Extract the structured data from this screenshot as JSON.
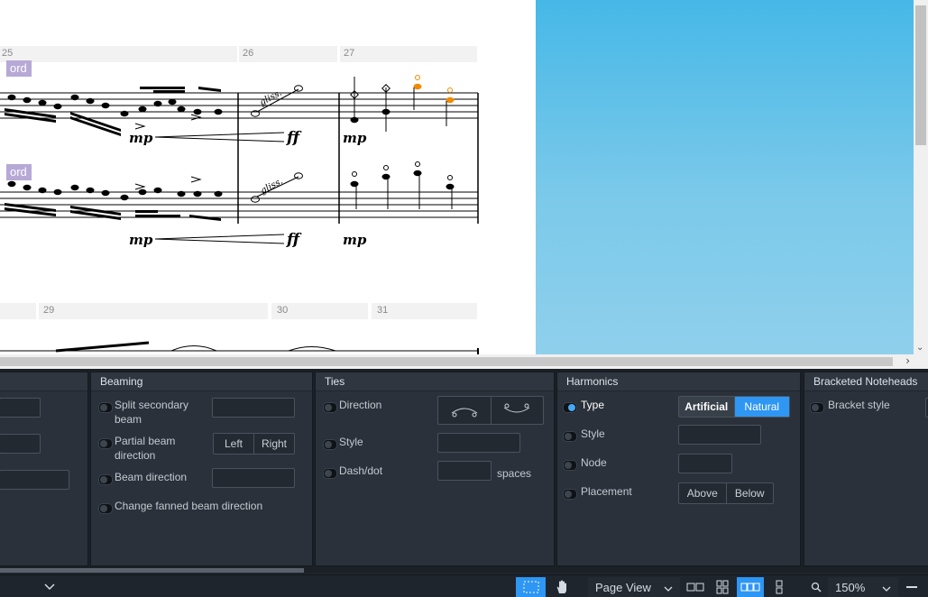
{
  "score": {
    "bar_numbers_top": [
      "25",
      "26",
      "27"
    ],
    "bar_numbers_bottom": [
      "29",
      "30",
      "31"
    ],
    "technique_top": "ord",
    "technique_bottom": "ord",
    "gliss_top": "gliss.",
    "gliss_bottom": "gliss.",
    "dyn_mp": "mp",
    "dyn_ff": "ff",
    "accent_color": "#f08a00",
    "highlight_color": "#b7a9d6"
  },
  "panels": {
    "beaming": {
      "title": "Beaming",
      "split_secondary": "Split secondary beam",
      "partial_direction": "Partial beam direction",
      "left": "Left",
      "right": "Right",
      "beam_direction": "Beam direction",
      "change_fanned": "Change fanned beam direction"
    },
    "ties": {
      "title": "Ties",
      "direction": "Direction",
      "style": "Style",
      "dash_dot": "Dash/dot",
      "spaces": "spaces"
    },
    "harmonics": {
      "title": "Harmonics",
      "type": "Type",
      "artificial": "Artificial",
      "natural": "Natural",
      "style": "Style",
      "node": "Node",
      "placement": "Placement",
      "above": "Above",
      "below": "Below"
    },
    "bracketed": {
      "title": "Bracketed Noteheads",
      "bracket_style": "Bracket style"
    }
  },
  "status": {
    "view_mode": "Page View",
    "zoom": "150%",
    "select_color": "#2e96f3"
  },
  "icons": [
    "chevron-down-icon",
    "selection-tool-icon",
    "hand-tool-icon",
    "chevron-right-icon",
    "zoom-icon",
    "minus-icon"
  ]
}
